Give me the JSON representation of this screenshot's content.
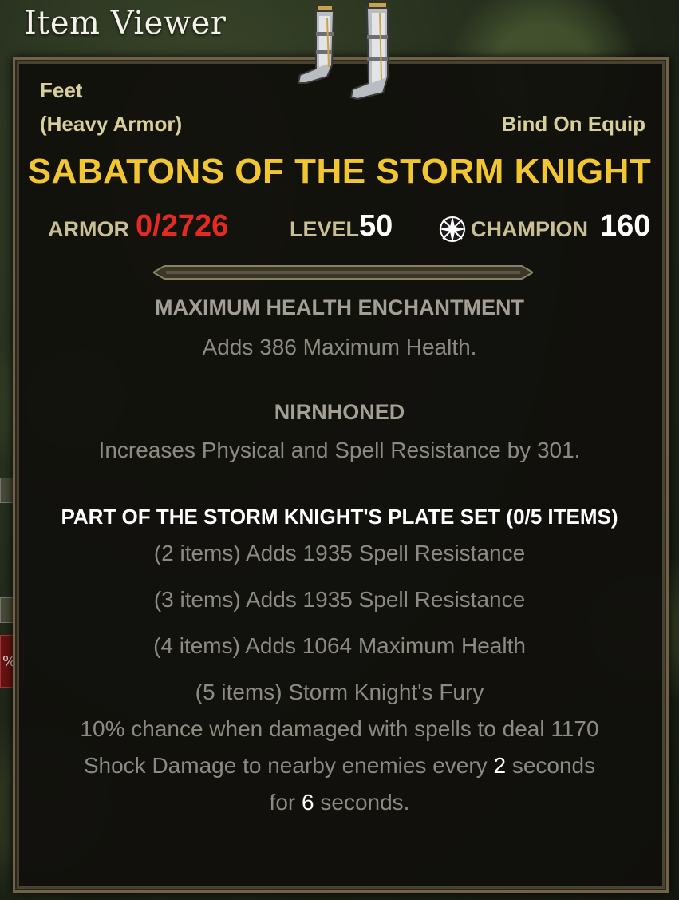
{
  "window": {
    "title": "Item Viewer"
  },
  "side": {
    "percent": "%"
  },
  "item": {
    "slot": "Feet",
    "armor_type": "(Heavy Armor)",
    "bind": "Bind On Equip",
    "name": "SABATONS OF THE STORM KNIGHT",
    "icon": "sabatons-icon"
  },
  "stats": {
    "armor_label": "ARMOR",
    "armor_value": "0/2726",
    "level_label": "LEVEL",
    "level_value": "50",
    "champion_icon": "champion-point-icon",
    "champion_label": "CHAMPION",
    "champion_value": "160"
  },
  "enchantment": {
    "title": "MAXIMUM HEALTH ENCHANTMENT",
    "text": "Adds 386 Maximum Health."
  },
  "trait": {
    "title": "NIRNHONED",
    "text": "Increases Physical and Spell Resistance by 301."
  },
  "set": {
    "title": "PART OF THE STORM KNIGHT'S PLATE SET (0/5 ITEMS)",
    "bonuses": [
      "(2 items) Adds 1935 Spell Resistance",
      "(3 items) Adds 1935 Spell Resistance",
      "(4 items) Adds 1064 Maximum Health",
      "(5 items) Storm Knight's Fury"
    ],
    "fury_line1": "10% chance when damaged with spells to deal 1170",
    "fury_line2_a": "Shock Damage to nearby enemies every ",
    "fury_line2_num": "2",
    "fury_line2_b": " seconds",
    "fury_line3_a": "for ",
    "fury_line3_num": "6",
    "fury_line3_b": " seconds."
  },
  "colors": {
    "item_name": "#f2c630",
    "armor_value": "#e52b20",
    "label": "#c9bf93",
    "heading": "#a39f95",
    "body": "#8d8a82"
  }
}
